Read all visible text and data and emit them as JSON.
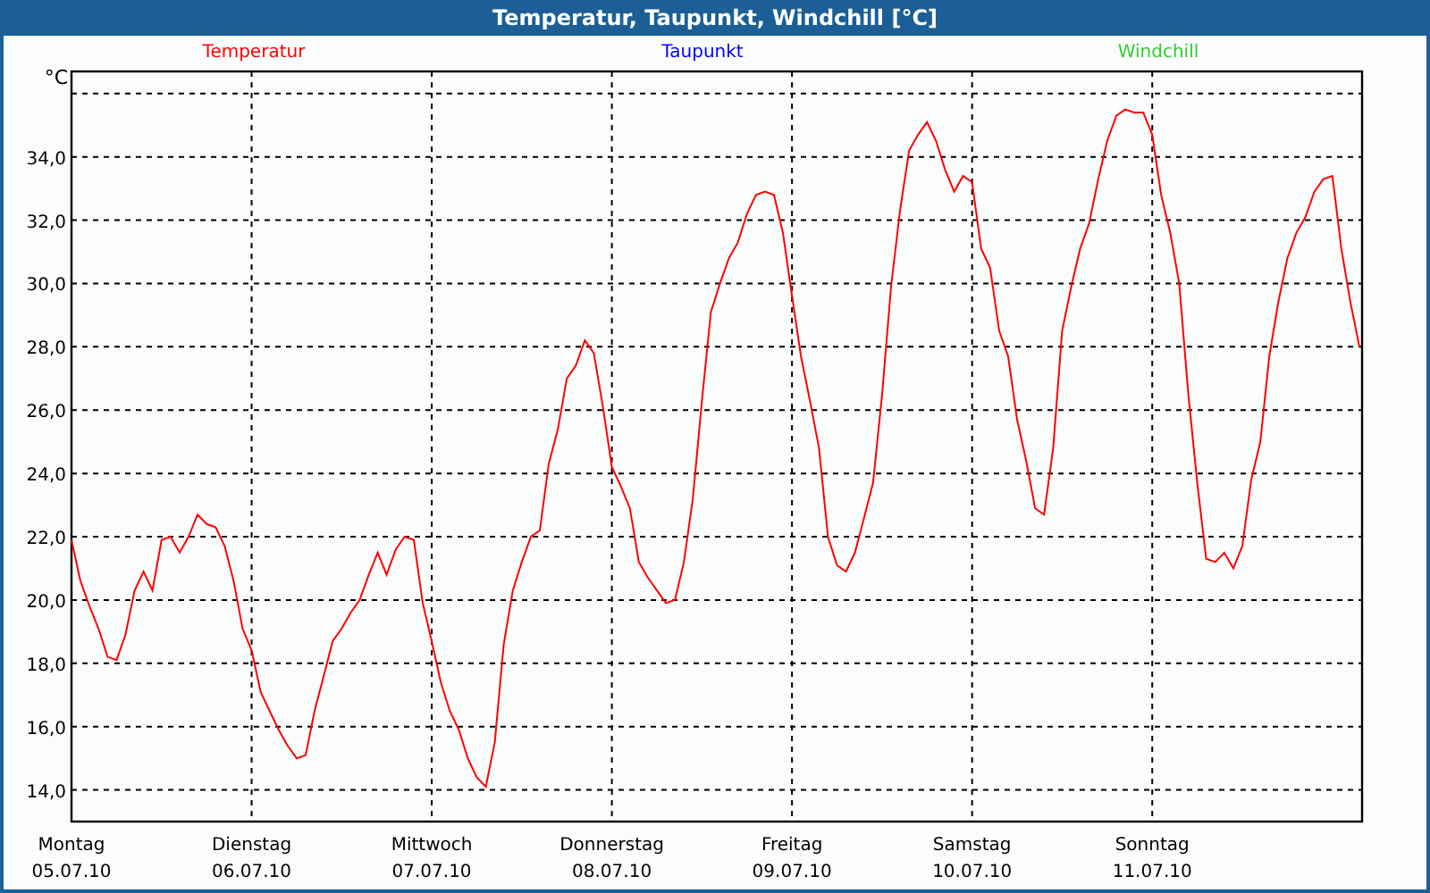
{
  "window": {
    "title": "Temperatur, Taupunkt, Windchill [°C]"
  },
  "legend": [
    {
      "label": "Taupunkt",
      "color": "#0000ff"
    },
    {
      "label": "Windchill",
      "color": "#33cc33"
    }
  ],
  "chart": {
    "chart_data": {
      "type": "line",
      "ylabel": "°C",
      "ylim": [
        13,
        36.7
      ],
      "grid": true,
      "categories": [
        "Montag\n05.07.10",
        null,
        null,
        null,
        null,
        null,
        null,
        null,
        null,
        null,
        null,
        null,
        null,
        null,
        null,
        null,
        null,
        null,
        null,
        null,
        "Dienstag\n06.07.10",
        null,
        null,
        null,
        null,
        null,
        null,
        null,
        null,
        null,
        null,
        null,
        null,
        null,
        null,
        null,
        null,
        null,
        null,
        null,
        "Mittwoch\n07.07.10",
        null,
        null,
        null,
        null,
        null,
        null,
        null,
        null,
        null,
        null,
        null,
        null,
        null,
        null,
        null,
        null,
        null,
        null,
        null,
        "Donnerstag\n08.07.10",
        null,
        null,
        null,
        null,
        null,
        null,
        null,
        null,
        null,
        null,
        null,
        null,
        null,
        null,
        null,
        null,
        null,
        null,
        null,
        "Freitag\n09.07.10",
        null,
        null,
        null,
        null,
        null,
        null,
        null,
        null,
        null,
        null,
        null,
        null,
        null,
        null,
        null,
        null,
        null,
        null,
        null,
        "Samstag\n10.07.10",
        null,
        null,
        null,
        null,
        null,
        null,
        null,
        null,
        null,
        null,
        null,
        null,
        null,
        null,
        null,
        null,
        null,
        null,
        null,
        "Sonntag\n11.07.10",
        null,
        null,
        null,
        null,
        null,
        null,
        null,
        null,
        null,
        null,
        null,
        null,
        null,
        null,
        null,
        null,
        null,
        null,
        null,
        null,
        null,
        null,
        null
      ],
      "yticks": [
        {
          "value": 14,
          "label": "14,0"
        },
        {
          "value": 16,
          "label": "16,0"
        },
        {
          "value": 18,
          "label": "18,0"
        },
        {
          "value": 20,
          "label": "20,0"
        },
        {
          "value": 22,
          "label": "22,0"
        },
        {
          "value": 24,
          "label": "24,0"
        },
        {
          "value": 26,
          "label": "26,0"
        },
        {
          "value": 28,
          "label": "28,0"
        },
        {
          "value": 30,
          "label": "30,0"
        },
        {
          "value": 32,
          "label": "32,0"
        },
        {
          "value": 34,
          "label": "34,0"
        }
      ],
      "series": [
        {
          "name": "Temperatur",
          "color": "#ff0000",
          "values": [
            21.9,
            20.6,
            19.8,
            19.1,
            18.2,
            18.1,
            18.9,
            20.3,
            20.9,
            20.3,
            21.9,
            22.0,
            21.5,
            22.0,
            22.7,
            22.4,
            22.3,
            21.7,
            20.6,
            19.1,
            18.4,
            17.1,
            16.5,
            15.9,
            15.4,
            15.0,
            15.1,
            16.5,
            17.6,
            18.7,
            19.1,
            19.6,
            20.0,
            20.8,
            21.5,
            20.8,
            21.6,
            22.0,
            21.9,
            19.9,
            18.7,
            17.4,
            16.5,
            15.9,
            15.0,
            14.4,
            14.1,
            15.5,
            18.6,
            20.3,
            21.2,
            22.0,
            22.2,
            24.3,
            25.4,
            27.0,
            27.4,
            28.2,
            27.8,
            26.1,
            24.2,
            23.6,
            22.9,
            21.2,
            20.7,
            20.3,
            19.9,
            20.0,
            21.2,
            23.2,
            26.3,
            29.1,
            30.0,
            30.8,
            31.3,
            32.2,
            32.8,
            32.9,
            32.8,
            31.6,
            29.6,
            27.7,
            26.3,
            24.8,
            22.0,
            21.1,
            20.9,
            21.5,
            22.6,
            23.7,
            26.5,
            29.9,
            32.3,
            34.2,
            34.7,
            35.1,
            34.5,
            33.6,
            32.9,
            33.4,
            33.2,
            31.1,
            30.5,
            28.5,
            27.7,
            25.7,
            24.4,
            22.9,
            22.7,
            24.8,
            28.5,
            29.9,
            31.1,
            31.9,
            33.3,
            34.5,
            35.3,
            35.5,
            35.4,
            35.4,
            34.7,
            32.8,
            31.6,
            30.0,
            26.5,
            23.7,
            21.3,
            21.2,
            21.5,
            21.0,
            21.7,
            23.8,
            25.0,
            27.7,
            29.4,
            30.8,
            31.6,
            32.1,
            32.9,
            33.3,
            33.4,
            31.1,
            29.4,
            28.0
          ]
        }
      ]
    }
  }
}
